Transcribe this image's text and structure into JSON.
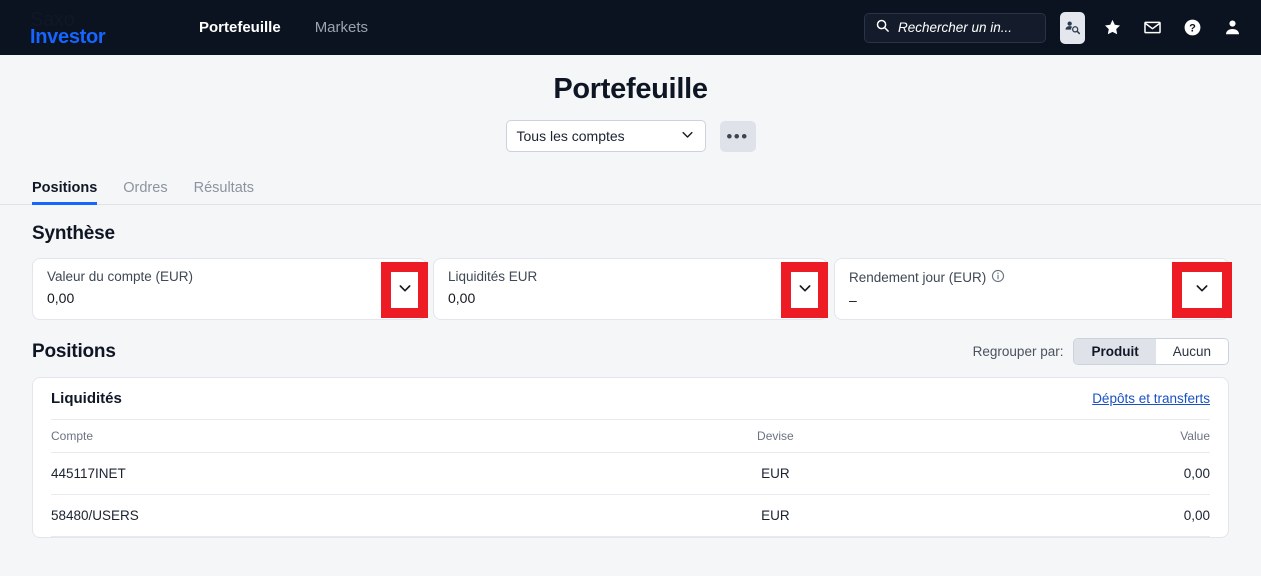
{
  "header": {
    "brand_line1": "Saxo",
    "brand_line2": "Investor",
    "nav": [
      {
        "label": "Portefeuille",
        "active": true
      },
      {
        "label": "Markets",
        "active": false
      }
    ],
    "search": {
      "value": "",
      "placeholder": "Rechercher un in..."
    },
    "icons": [
      "account-search-icon",
      "star-icon",
      "mail-icon",
      "help-icon",
      "user-icon"
    ]
  },
  "page": {
    "title": "Portefeuille",
    "account_selector": "Tous les comptes",
    "more_button": "•••"
  },
  "tabs": [
    {
      "label": "Positions",
      "active": true
    },
    {
      "label": "Ordres",
      "active": false
    },
    {
      "label": "Résultats",
      "active": false
    }
  ],
  "summary": {
    "title": "Synthèse",
    "cards": [
      {
        "label": "Valeur du compte (EUR)",
        "value": "0,00",
        "info": false
      },
      {
        "label": "Liquidités EUR",
        "value": "0,00",
        "info": false
      },
      {
        "label": "Rendement jour (EUR)",
        "value": "–",
        "info": true
      }
    ]
  },
  "positions": {
    "title": "Positions",
    "group_by_label": "Regrouper par:",
    "group_options": [
      {
        "label": "Produit",
        "selected": true
      },
      {
        "label": "Aucun",
        "selected": false
      }
    ]
  },
  "cash_panel": {
    "title": "Liquidités",
    "link": "Dépôts et transferts",
    "columns": [
      "Compte",
      "Devise",
      "Value"
    ],
    "rows": [
      {
        "account": "445117INET",
        "currency": "EUR",
        "value": "0,00"
      },
      {
        "account": "58480/USERS",
        "currency": "EUR",
        "value": "0,00"
      }
    ]
  },
  "colors": {
    "accent": "#1565ff",
    "annotation": "#ed1c24",
    "topbar": "#0b1220",
    "link": "#1a52c4"
  }
}
